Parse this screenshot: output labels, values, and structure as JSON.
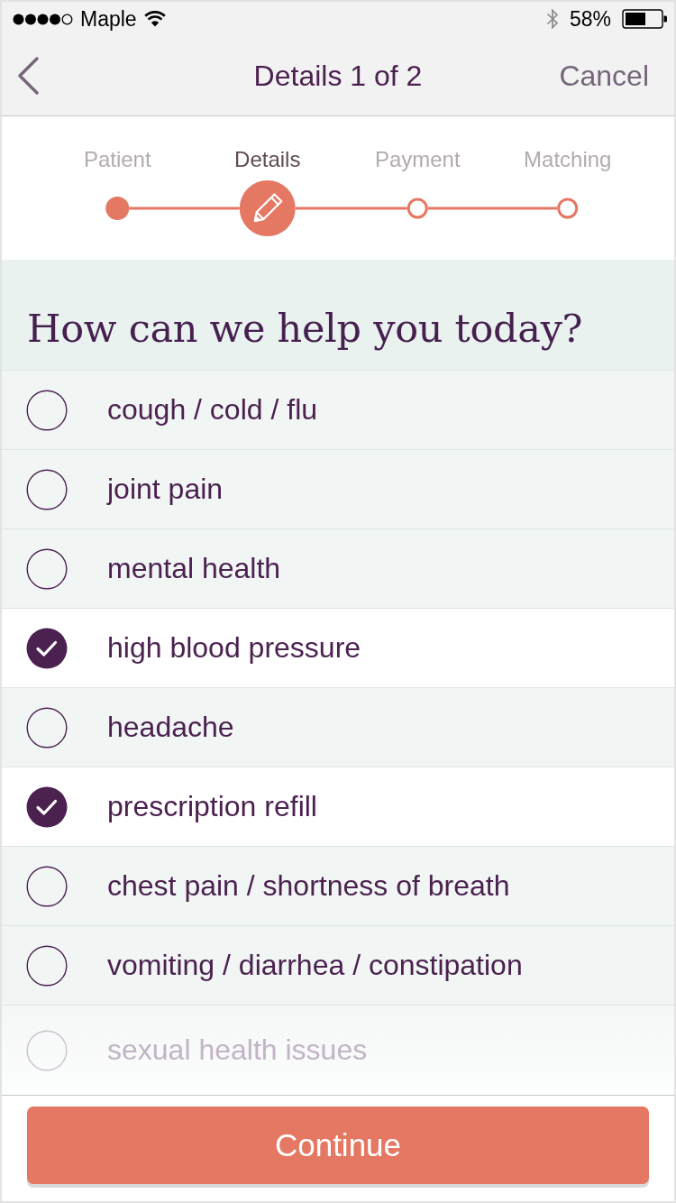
{
  "status_bar": {
    "carrier": "Maple",
    "battery": "58%"
  },
  "nav": {
    "title": "Details 1 of 2",
    "cancel": "Cancel"
  },
  "steps": [
    {
      "label": "Patient",
      "completed": true,
      "selected": false
    },
    {
      "label": "Details",
      "completed": false,
      "selected": true
    },
    {
      "label": "Payment",
      "completed": false,
      "selected": false
    },
    {
      "label": "Matching",
      "completed": false,
      "selected": false
    }
  ],
  "question": "How can we help you today?",
  "options": [
    {
      "label": "cough / cold / flu",
      "checked": false,
      "faded": false
    },
    {
      "label": "joint pain",
      "checked": false,
      "faded": false
    },
    {
      "label": "mental health",
      "checked": false,
      "faded": false
    },
    {
      "label": "high blood pressure",
      "checked": true,
      "faded": false
    },
    {
      "label": "headache",
      "checked": false,
      "faded": false
    },
    {
      "label": "prescription refill",
      "checked": true,
      "faded": false
    },
    {
      "label": "chest pain / shortness of breath",
      "checked": false,
      "faded": false
    },
    {
      "label": "vomiting / diarrhea / constipation",
      "checked": false,
      "faded": false
    },
    {
      "label": "sexual health issues",
      "checked": false,
      "faded": true
    }
  ],
  "continue_button": "Continue"
}
